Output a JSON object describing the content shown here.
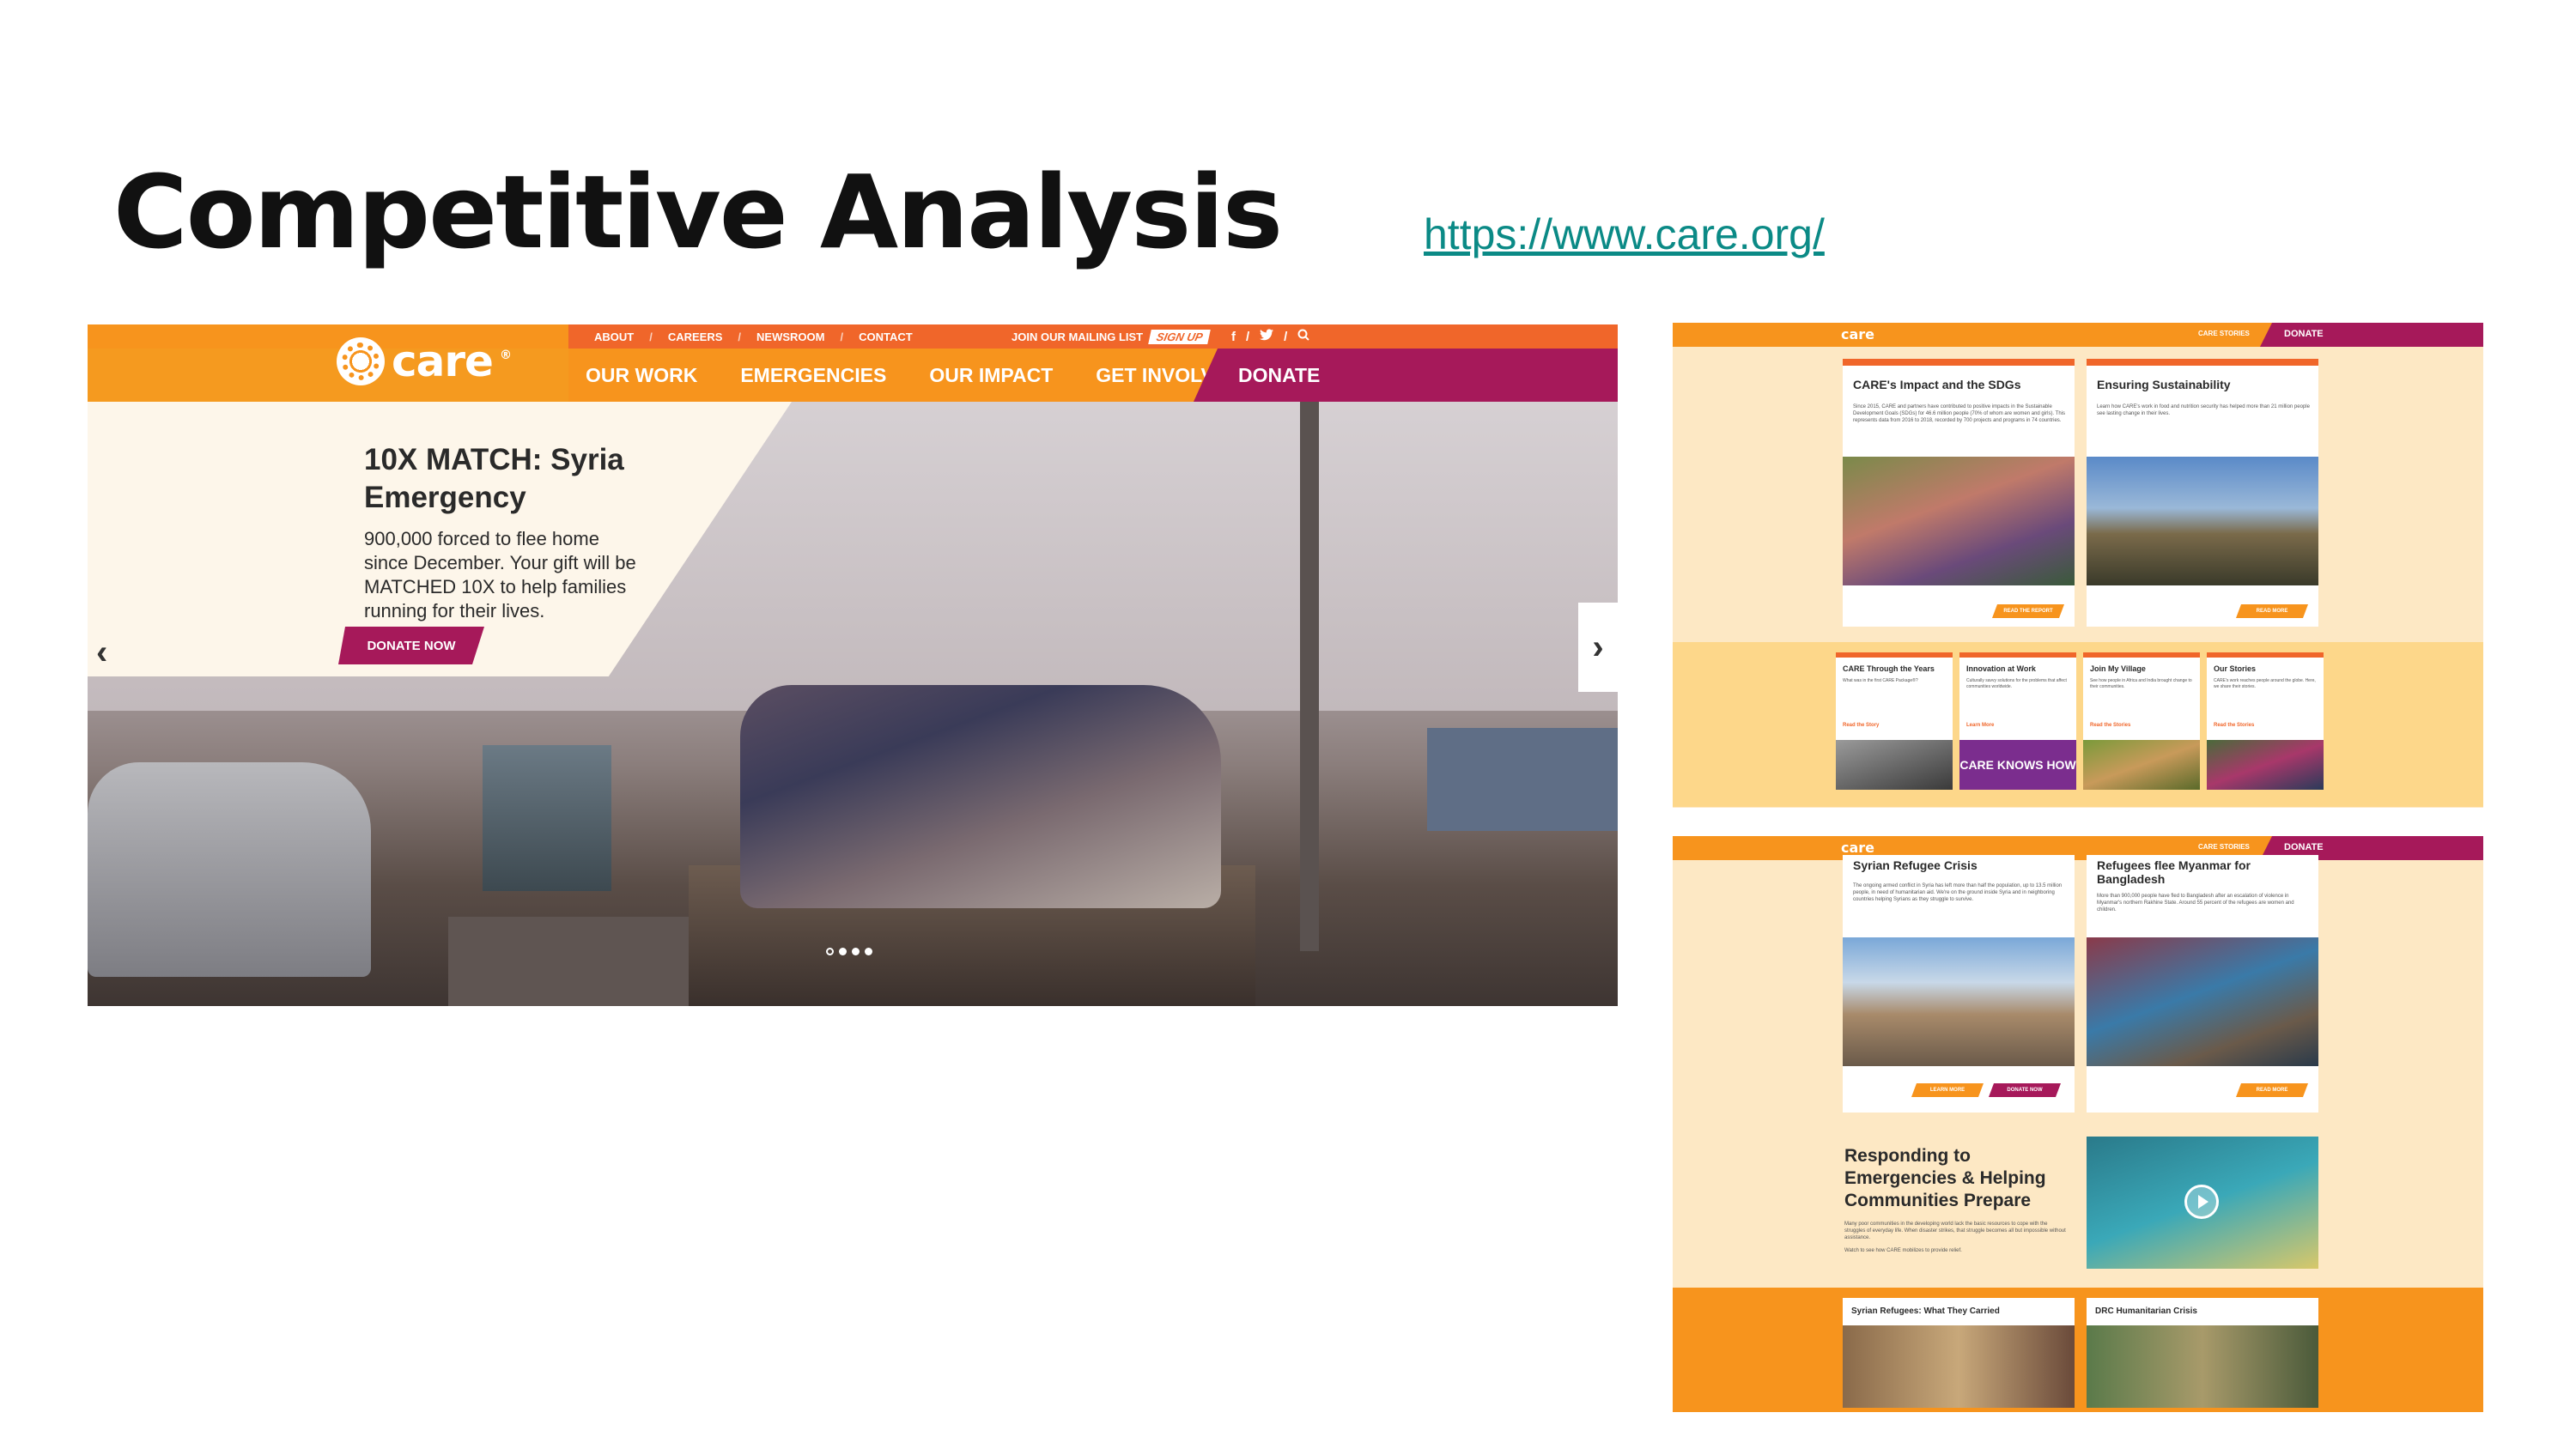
{
  "slide": {
    "title": "Competitive Analysis",
    "link": "https://www.care.org/"
  },
  "main_site": {
    "utility_nav": [
      "ABOUT",
      "CAREERS",
      "NEWSROOM",
      "CONTACT"
    ],
    "mailing_list": "JOIN OUR MAILING LIST",
    "signup": "SIGN UP",
    "logo_text": "care",
    "main_nav": [
      "OUR WORK",
      "EMERGENCIES",
      "OUR IMPACT",
      "GET INVOLVED"
    ],
    "donate": "DONATE",
    "hero": {
      "headline": "10X MATCH: Syria Emergency",
      "body": "900,000 forced to flee home since December. Your gift will be MATCHED 10X to help families running for their lives.",
      "cta": "DONATE NOW"
    },
    "carousel": {
      "slides": 4,
      "active": 0
    }
  },
  "right_top": {
    "logo_text": "care",
    "nav_link": "CARE STORIES",
    "donate": "DONATE",
    "cards": [
      {
        "title": "CARE's Impact and the SDGs",
        "body": "Since 2015, CARE and partners have contributed to positive impacts in the Sustainable Development Goals (SDGs) for 46.6 million people (70% of whom are women and girls). This represents data from 2016 to 2018, recorded by 700 projects and programs in 74 countries.",
        "button": "READ THE REPORT"
      },
      {
        "title": "Ensuring Sustainability",
        "body": "Learn how CARE's work in food and nutrition security has helped more than 21 million people see lasting change in their lives.",
        "button": "READ MORE"
      }
    ],
    "small_cards": [
      {
        "title": "CARE Through the Years",
        "body": "What was in the first CARE Package®?",
        "link": "Read the Story"
      },
      {
        "title": "Innovation at Work",
        "body": "Culturally savvy solutions for the problems that affect communities worldwide.",
        "link": "Learn More"
      },
      {
        "title": "Join My Village",
        "body": "See how people in Africa and India brought change to their communities.",
        "link": "Read the Stories"
      },
      {
        "title": "Our Stories",
        "body": "CARE's work reaches people around the globe. Here, we share their stories.",
        "link": "Read the Stories"
      }
    ],
    "badge_text": "CARE KNOWS HOW"
  },
  "right_bottom": {
    "logo_text": "care",
    "nav_link": "CARE STORIES",
    "donate": "DONATE",
    "cards": [
      {
        "title": "Syrian Refugee Crisis",
        "body": "The ongoing armed conflict in Syria has left more than half the population, up to 13.5 million people, in need of humanitarian aid. We're on the ground inside Syria and in neighboring countries helping Syrians as they struggle to survive.",
        "buttons": [
          "LEARN MORE",
          "DONATE NOW"
        ]
      },
      {
        "title": "Refugees flee Myanmar for Bangladesh",
        "body": "More than 900,000 people have fled to Bangladesh after an escalation of violence in Myanmar's northern Rakhine State. Around 55 percent of the refugees are women and children.",
        "buttons": [
          "READ MORE"
        ]
      }
    ],
    "feature": {
      "title": "Responding to Emergencies & Helping Communities Prepare",
      "body": "Many poor communities in the developing world lack the basic resources to cope with the struggles of everyday life. When disaster strikes, that struggle becomes all but impossible without assistance.",
      "watch": "Watch to see how CARE mobilizes to provide relief."
    },
    "video_cards": [
      "Syrian Refugees: What They Carried",
      "DRC Humanitarian Crisis"
    ]
  },
  "colors": {
    "orange": "#f7941d",
    "deep_orange": "#f0662a",
    "maroon": "#a6195a",
    "cream": "#fdf6ea",
    "link_teal": "#0b8a86"
  }
}
